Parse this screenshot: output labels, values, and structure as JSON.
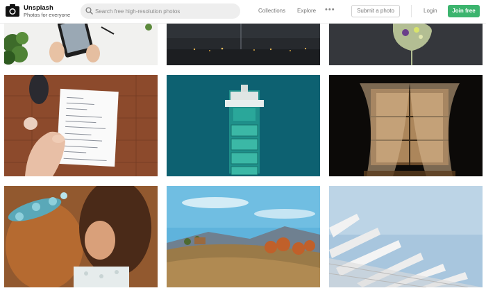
{
  "app": {
    "name": "Unsplash",
    "tagline": "Photos for everyone"
  },
  "search": {
    "placeholder": "Search free high-resolution photos",
    "value": ""
  },
  "nav": {
    "collections": "Collections",
    "explore": "Explore",
    "more": "•••",
    "submit": "Submit a photo",
    "login": "Login",
    "join": "Join free"
  },
  "colors": {
    "join_button": "#3cb46e",
    "search_bg": "#eeeeee"
  },
  "photos": [
    {
      "subject": "hands holding tablet on white desk"
    },
    {
      "subject": "city lights at night"
    },
    {
      "subject": "wine glass with flowers"
    },
    {
      "subject": "hand holding handwritten note"
    },
    {
      "subject": "aerial view of ship on teal water"
    },
    {
      "subject": "sunlit curtain in dark room"
    },
    {
      "subject": "couple embracing with flower crown"
    },
    {
      "subject": "hillside village under blue sky"
    },
    {
      "subject": "white architectural ribs against sky"
    }
  ]
}
